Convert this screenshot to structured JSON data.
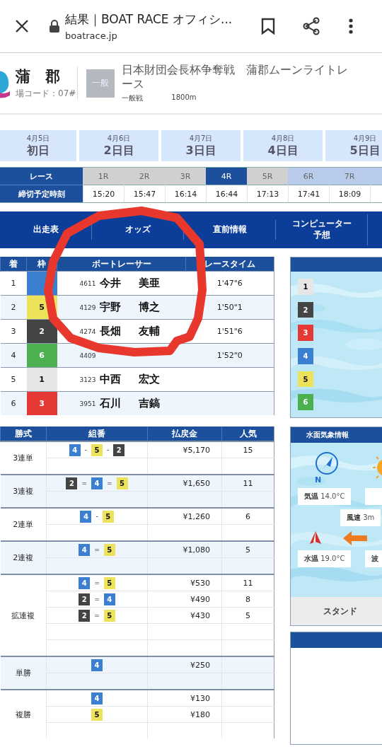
{
  "browser": {
    "title": "結果｜BOAT RACE オフィシ...",
    "url": "boatrace.jp"
  },
  "header": {
    "venue": "蒲　郡",
    "venue_code": "場コード：07#",
    "grade": "一般",
    "race_title": "日本財団会長杯争奪戦　蒲郡ムーンライトレース",
    "race_type": "一般戦",
    "distance": "1800m"
  },
  "days": [
    {
      "date": "4月5日",
      "label": "初日"
    },
    {
      "date": "4月6日",
      "label": "2日目"
    },
    {
      "date": "4月7日",
      "label": "3日目"
    },
    {
      "date": "4月8日",
      "label": "4日目"
    },
    {
      "date": "4月9日",
      "label": "5日目"
    }
  ],
  "race_table": {
    "row_headers": [
      "レース",
      "締切予定時刻"
    ],
    "races": [
      {
        "label": "1R",
        "time": "15:20",
        "finished": true,
        "selected": false
      },
      {
        "label": "2R",
        "time": "15:47",
        "finished": true,
        "selected": false
      },
      {
        "label": "3R",
        "time": "16:14",
        "finished": true,
        "selected": false
      },
      {
        "label": "4R",
        "time": "16:44",
        "finished": true,
        "selected": true
      },
      {
        "label": "5R",
        "time": "17:13",
        "finished": true,
        "selected": false
      },
      {
        "label": "6R",
        "time": "17:41",
        "finished": false,
        "selected": false
      },
      {
        "label": "7R",
        "time": "18:09",
        "finished": false,
        "selected": false
      },
      {
        "finished": false,
        "selected": false
      }
    ]
  },
  "nav_tabs": [
    {
      "label": "出走表"
    },
    {
      "label": "オッズ"
    },
    {
      "label": "直前情報"
    },
    {
      "label": "コンピューター予想"
    }
  ],
  "results": {
    "columns": [
      "着",
      "枠",
      "ボートレーサー",
      "レースタイム"
    ],
    "rows": [
      {
        "place": "1",
        "boat": {
          "color": "#3a7fd0"
        },
        "reg_no": "4611",
        "surname": "今井",
        "given_name": "美亜",
        "time": "1'47\"6"
      },
      {
        "place": "2",
        "boat": {
          "number": "5",
          "color": "#ede35a"
        },
        "reg_no": "4129",
        "surname": "宇野",
        "given_name": "博之",
        "time": "1'50\"1"
      },
      {
        "place": "3",
        "boat": {
          "number": "2",
          "color": "#444444"
        },
        "reg_no": "4274",
        "surname": "長畑",
        "given_name": "友輔",
        "time": "1'51\"6"
      },
      {
        "place": "4",
        "boat": {
          "number": "6",
          "color": "#4caf50"
        },
        "reg_no": "4409",
        "time": "1'52\"0"
      },
      {
        "place": "5",
        "boat": {
          "number": "1",
          "color": "#e6e6e6"
        },
        "reg_no": "3123",
        "surname": "中西",
        "given_name": "宏文"
      },
      {
        "place": "6",
        "boat": {
          "number": "3",
          "color": "#e53935"
        },
        "reg_no": "3951",
        "surname": "石川",
        "given_name": "吉鎬"
      }
    ]
  },
  "start_panel": {
    "boats": [
      {
        "number": "1",
        "color": "#e6e6e6"
      },
      {
        "number": "2",
        "color": "#444444"
      },
      {
        "number": "3",
        "color": "#e53935"
      },
      {
        "number": "4",
        "color": "#3a7fd0"
      },
      {
        "number": "5",
        "color": "#ede35a"
      },
      {
        "number": "6",
        "color": "#4caf50"
      }
    ]
  },
  "payouts": {
    "columns": [
      "勝式",
      "組番",
      "払戻金",
      "人気"
    ],
    "groups": [
      {
        "type": "3連単",
        "rows": [
          {
            "kind": "entry",
            "sep": "-",
            "boats": [
              {
                "number": "4",
                "color": "#3a7fd0"
              },
              {
                "number": "5",
                "color": "#ede35a"
              },
              {
                "number": "2",
                "color": "#444444"
              }
            ],
            "amount": "¥5,170",
            "popularity": "15"
          },
          {
            "kind": "blank"
          }
        ]
      },
      {
        "type": "3連複",
        "rows": [
          {
            "kind": "entry",
            "sep": "=",
            "boats": [
              {
                "number": "2",
                "color": "#444444"
              },
              {
                "number": "4",
                "color": "#3a7fd0"
              },
              {
                "number": "5",
                "color": "#ede35a"
              }
            ],
            "amount": "¥1,650",
            "popularity": "11"
          },
          {
            "kind": "blank"
          }
        ]
      },
      {
        "type": "2連単",
        "rows": [
          {
            "kind": "entry",
            "sep": "-",
            "boats": [
              {
                "number": "4",
                "color": "#3a7fd0"
              },
              {
                "number": "5",
                "color": "#ede35a"
              }
            ],
            "amount": "¥1,260",
            "popularity": "6"
          },
          {
            "kind": "blank"
          }
        ]
      },
      {
        "type": "2連複",
        "rows": [
          {
            "kind": "entry",
            "sep": "=",
            "boats": [
              {
                "number": "4",
                "color": "#3a7fd0"
              },
              {
                "number": "5",
                "color": "#ede35a"
              }
            ],
            "amount": "¥1,080",
            "popularity": "5"
          },
          {
            "kind": "blank"
          }
        ]
      },
      {
        "type": "拡連複",
        "rows": [
          {
            "kind": "entry",
            "sep": "=",
            "boats": [
              {
                "number": "4",
                "color": "#3a7fd0"
              },
              {
                "number": "5",
                "color": "#ede35a"
              }
            ],
            "amount": "¥530",
            "popularity": "11"
          },
          {
            "kind": "entry",
            "sep": "=",
            "boats": [
              {
                "number": "2",
                "color": "#444444"
              },
              {
                "number": "4",
                "color": "#3a7fd0"
              }
            ],
            "amount": "¥490",
            "popularity": "8"
          },
          {
            "kind": "entry",
            "sep": "=",
            "boats": [
              {
                "number": "2",
                "color": "#444444"
              },
              {
                "number": "5",
                "color": "#ede35a"
              }
            ],
            "amount": "¥430",
            "popularity": "5"
          },
          {
            "kind": "blank"
          },
          {
            "kind": "blank"
          }
        ]
      },
      {
        "type": "単勝",
        "rows": [
          {
            "kind": "entry",
            "boats": [
              {
                "number": "4",
                "color": "#3a7fd0"
              }
            ],
            "amount": "¥250"
          },
          {
            "kind": "blank"
          }
        ]
      },
      {
        "type": "複勝",
        "rows": [
          {
            "kind": "entry",
            "boats": [
              {
                "number": "4",
                "color": "#3a7fd0"
              }
            ],
            "amount": "¥130"
          },
          {
            "kind": "entry",
            "boats": [
              {
                "number": "5",
                "color": "#ede35a"
              }
            ],
            "amount": "¥180"
          },
          {
            "kind": "blank"
          }
        ]
      }
    ]
  },
  "weather": {
    "title": "水面気象情報",
    "compass_label": "N",
    "temperature": {
      "label": "気温",
      "value": "14.0°C"
    },
    "wind": {
      "label": "風速",
      "value": "3m"
    },
    "water_temp": {
      "label": "水温",
      "value": "19.0°C"
    },
    "wave_label": "波",
    "stand": "スタンド"
  }
}
